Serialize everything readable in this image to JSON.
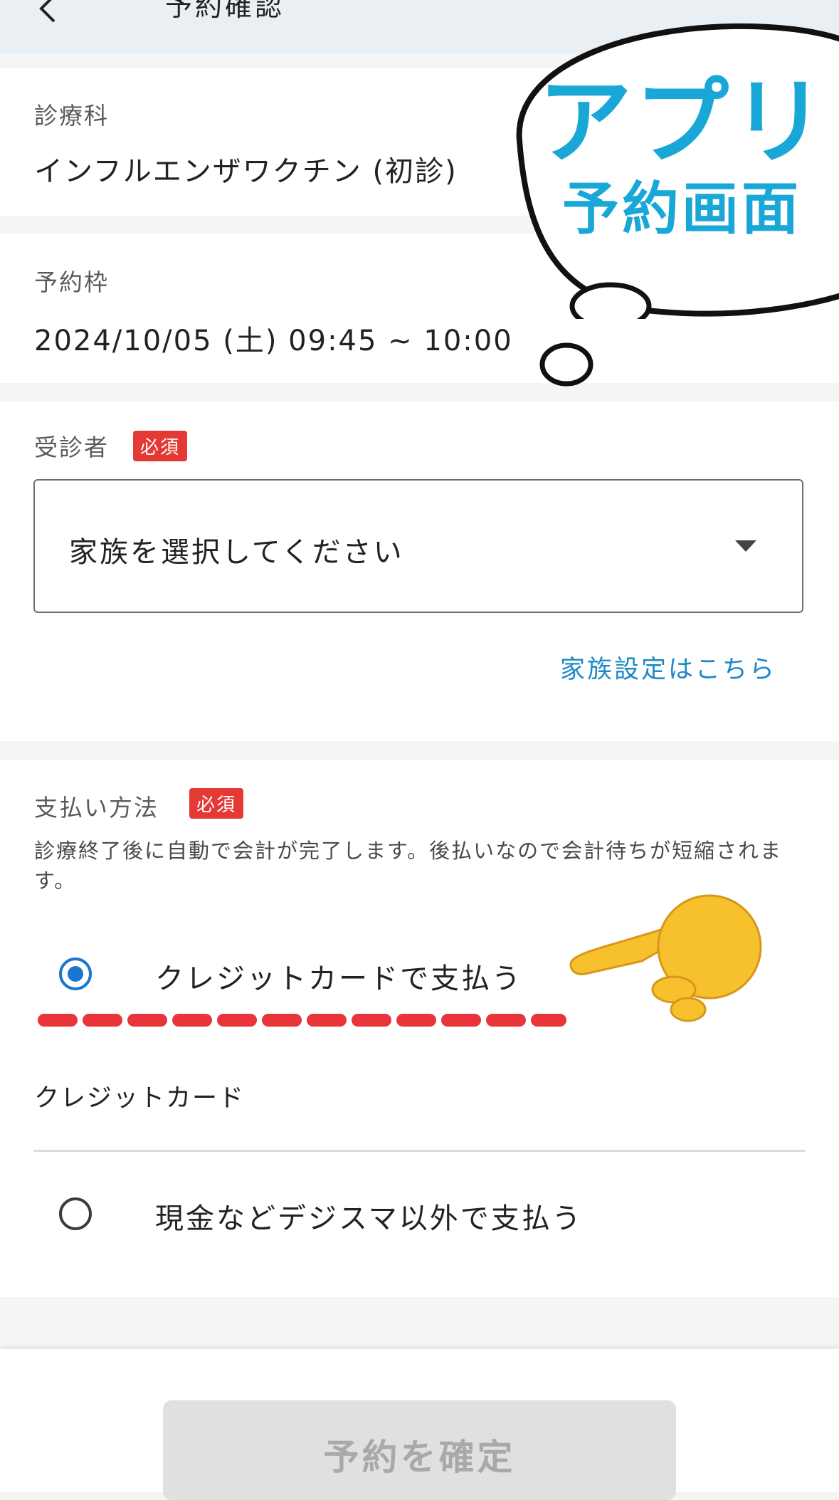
{
  "header": {
    "title": "予約確認",
    "back_icon": "chevron-left-icon"
  },
  "department": {
    "label": "診療科",
    "value": "インフルエンザワクチン (初診)"
  },
  "slot": {
    "label": "予約枠",
    "value": "2024/10/05 (土) 09:45 ~ 10:00"
  },
  "patient": {
    "label": "受診者",
    "required_badge": "必須",
    "select_placeholder": "家族を選択してください",
    "family_settings_link": "家族設定はこちら"
  },
  "payment": {
    "label": "支払い方法",
    "required_badge": "必須",
    "description": "診療終了後に自動で会計が完了します。後払いなので会計待ちが短縮されます。",
    "options": [
      {
        "label": "クレジットカードで支払う",
        "selected": true
      },
      {
        "label": "現金などデジスマ以外で支払う",
        "selected": false
      }
    ],
    "credit_card_label": "クレジットカード"
  },
  "footer": {
    "confirm_label": "予約を確定"
  },
  "annotation": {
    "bubble_line1": "アプリ",
    "bubble_line2": "予約画面",
    "pointing_icon": "pointing-hand-icon"
  },
  "colors": {
    "accent": "#1976d2",
    "link": "#1e88c7",
    "badge": "#e53935",
    "annotation": "#18a7d6",
    "dash": "#e8343a"
  }
}
